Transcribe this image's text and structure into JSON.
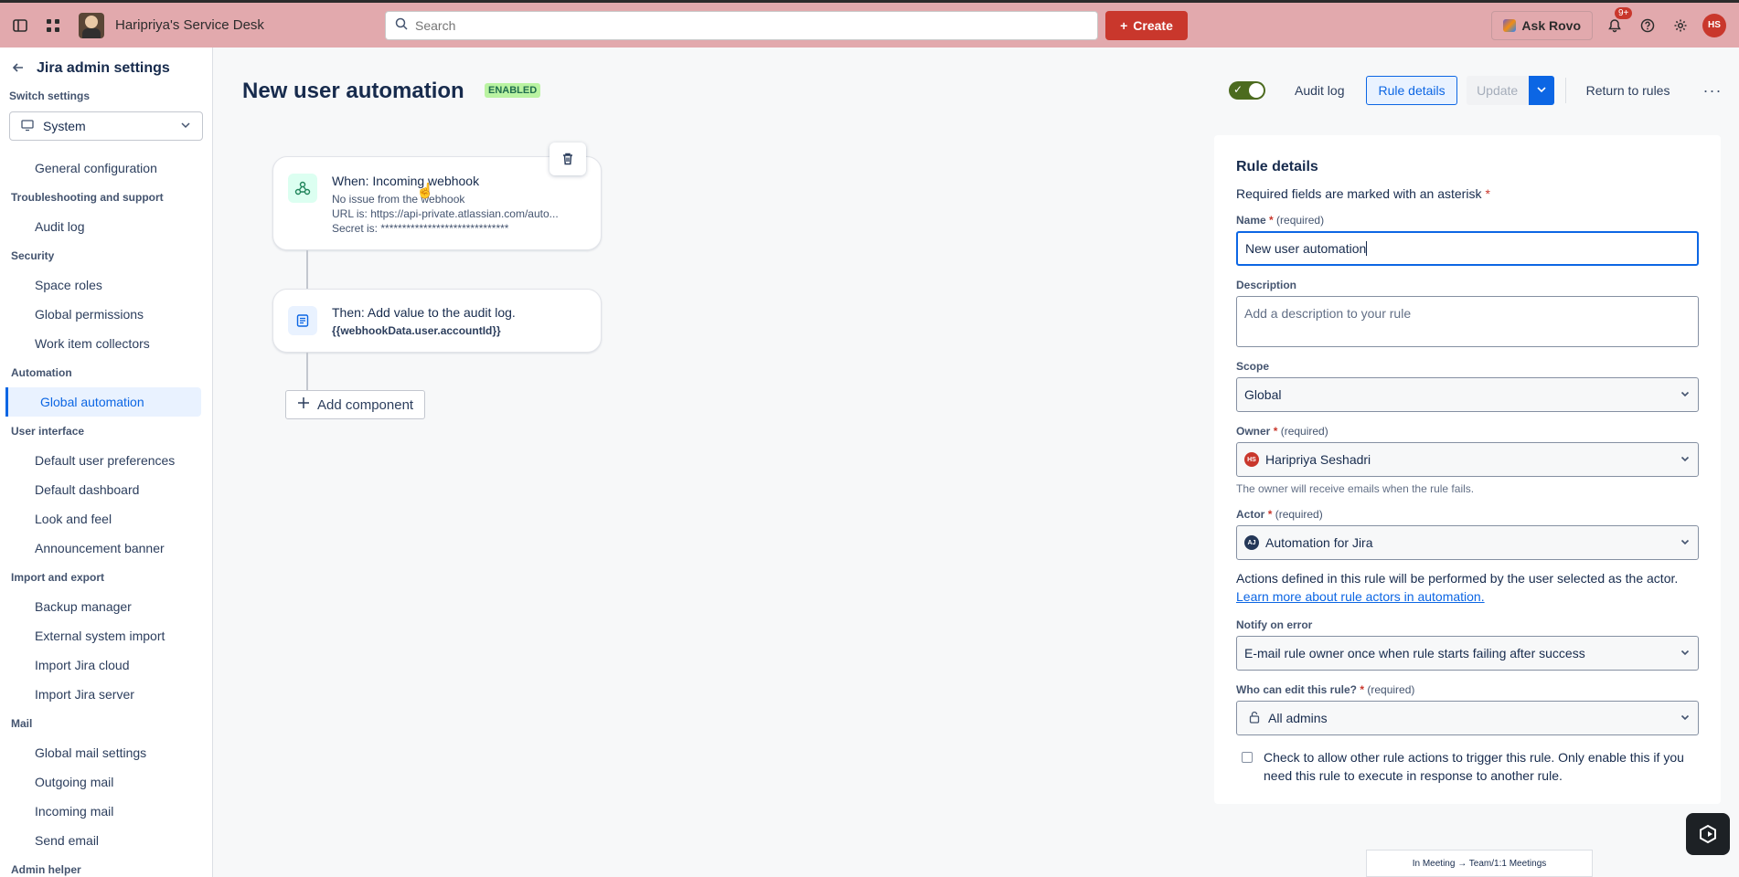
{
  "topbar": {
    "site_name": "Haripriya's Service Desk",
    "search_placeholder": "Search",
    "create_label": "Create",
    "ask_rovo_label": "Ask Rovo",
    "notifications_badge": "9+",
    "avatar_initials": "HS",
    "icons": [
      "sidebar-toggle-icon",
      "app-switcher-icon",
      "search-icon",
      "plus-icon",
      "bell-icon",
      "help-icon",
      "gear-icon"
    ]
  },
  "sidebar": {
    "title": "Jira admin settings",
    "switch_label": "Switch settings",
    "switch_value": "System",
    "sections": [
      {
        "heading": "",
        "items": [
          "General configuration"
        ]
      },
      {
        "heading": "Troubleshooting and support",
        "items": [
          "Audit log"
        ]
      },
      {
        "heading": "Security",
        "items": [
          "Space roles",
          "Global permissions",
          "Work item collectors"
        ]
      },
      {
        "heading": "Automation",
        "items": [
          "Global automation"
        ]
      },
      {
        "heading": "User interface",
        "items": [
          "Default user preferences",
          "Default dashboard",
          "Look and feel",
          "Announcement banner"
        ]
      },
      {
        "heading": "Import and export",
        "items": [
          "Backup manager",
          "External system import",
          "Import Jira cloud",
          "Import Jira server"
        ]
      },
      {
        "heading": "Mail",
        "items": [
          "Global mail settings",
          "Outgoing mail",
          "Incoming mail",
          "Send email"
        ]
      },
      {
        "heading": "Admin helper",
        "items": []
      }
    ],
    "active_item": "Global automation"
  },
  "header": {
    "title": "New user automation",
    "status": "ENABLED",
    "toggle_on": true,
    "audit_log": "Audit log",
    "rule_details": "Rule details",
    "update": "Update",
    "return": "Return to rules",
    "more": "···"
  },
  "canvas": {
    "trigger": {
      "title": "When: Incoming webhook",
      "line1": "No issue from the webhook",
      "line2": "URL is: https://api-private.atlassian.com/auto...",
      "line3": "Secret is: ******************************"
    },
    "action": {
      "title": "Then: Add value to the audit log.",
      "line1": "{{webhookData.user.accountId}}"
    },
    "add_component": "Add component"
  },
  "panel": {
    "title": "Rule details",
    "required_note": "Required fields are marked with an asterisk",
    "name_label": "Name",
    "name_value": "New user automation",
    "required_tag": "(required)",
    "description_label": "Description",
    "description_placeholder": "Add a description to your rule",
    "scope_label": "Scope",
    "scope_value": "Global",
    "owner_label": "Owner",
    "owner_value": "Haripriya Seshadri",
    "owner_initials": "HS",
    "owner_help": "The owner will receive emails when the rule fails.",
    "actor_label": "Actor",
    "actor_value": "Automation for Jira",
    "actor_initials": "AJ",
    "actor_info": "Actions defined in this rule will be performed by the user selected as the actor.",
    "actor_link": "Learn more about rule actors in automation.",
    "notify_label": "Notify on error",
    "notify_value": "E-mail rule owner once when rule starts failing after success",
    "editors_label": "Who can edit this rule?",
    "editors_value": "All admins",
    "checkbox_text": "Check to allow other rule actions to trigger this rule. Only enable this if you need this rule to execute in response to another rule.",
    "checkbox_checked": false
  },
  "footer": {
    "meeting": "In Meeting → Team/1:1 Meetings"
  },
  "colors": {
    "topbar": "#e2a9ad",
    "create": "#c9372c",
    "primary": "#0c66e4",
    "enabled_bg": "#baf3a2",
    "toggle": "#4c6b1f"
  }
}
